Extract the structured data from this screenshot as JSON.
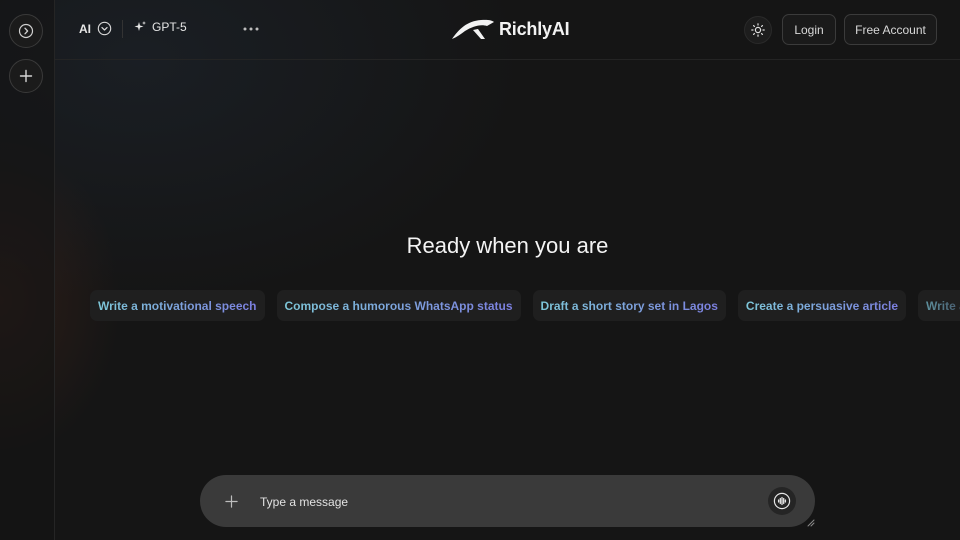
{
  "rail": {
    "toggle_icon": "chevron-right-circle-icon",
    "new_chat_icon": "plus-icon"
  },
  "header": {
    "mode_label": "AI",
    "model_label": "GPT-5",
    "logo_text": "RichlyAI",
    "login_label": "Login",
    "free_account_label": "Free Account"
  },
  "hero": {
    "title": "Ready when you are"
  },
  "suggestions": [
    "Write a motivational speech",
    "Compose a humorous WhatsApp status",
    "Draft a short story set in Lagos",
    "Create a persuasive article",
    "Write a di"
  ],
  "composer": {
    "placeholder": "Type a message"
  },
  "colors": {
    "background": "#151515",
    "composer": "#3a3a3a",
    "chip_gradient_start": "#7ec7d9",
    "chip_gradient_end": "#7c7fe0"
  }
}
